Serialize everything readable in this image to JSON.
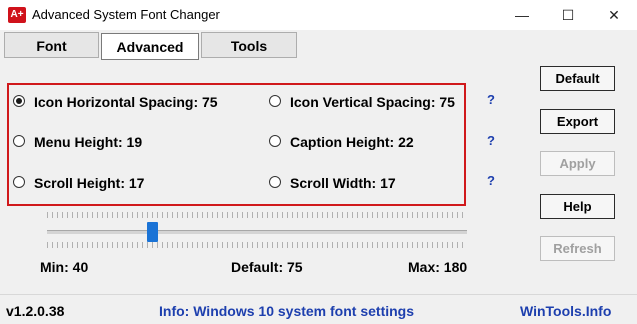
{
  "window": {
    "app_icon_text": "A+",
    "title": "Advanced System Font Changer",
    "minimize_glyph": "—",
    "maximize_glyph": "☐",
    "close_glyph": "✕"
  },
  "tabs": [
    {
      "label": "Font",
      "active": false
    },
    {
      "label": "Advanced",
      "active": true
    },
    {
      "label": "Tools",
      "active": false
    }
  ],
  "options": {
    "icon_horizontal_spacing": {
      "label": "Icon Horizontal Spacing: 75",
      "selected": true
    },
    "icon_vertical_spacing": {
      "label": "Icon Vertical Spacing: 75",
      "selected": false
    },
    "menu_height": {
      "label": "Menu Height: 19",
      "selected": false
    },
    "caption_height": {
      "label": "Caption Height: 22",
      "selected": false
    },
    "scroll_height": {
      "label": "Scroll Height: 17",
      "selected": false
    },
    "scroll_width": {
      "label": "Scroll Width: 17",
      "selected": false
    }
  },
  "help_marks": [
    "?",
    "?",
    "?"
  ],
  "buttons": {
    "default": "Default",
    "export": "Export",
    "apply": "Apply",
    "help": "Help",
    "refresh": "Refresh"
  },
  "slider": {
    "min": 40,
    "max": 180,
    "value": 75,
    "min_label": "Min: 40",
    "default_label": "Default: 75",
    "max_label": "Max: 180"
  },
  "status": {
    "version": "v1.2.0.38",
    "info": "Info: Windows 10 system font settings",
    "brand": "WinTools.Info"
  },
  "colors": {
    "highlight_border": "#d0191b",
    "link_blue": "#1d3fae",
    "slider_thumb": "#1a73d6"
  }
}
